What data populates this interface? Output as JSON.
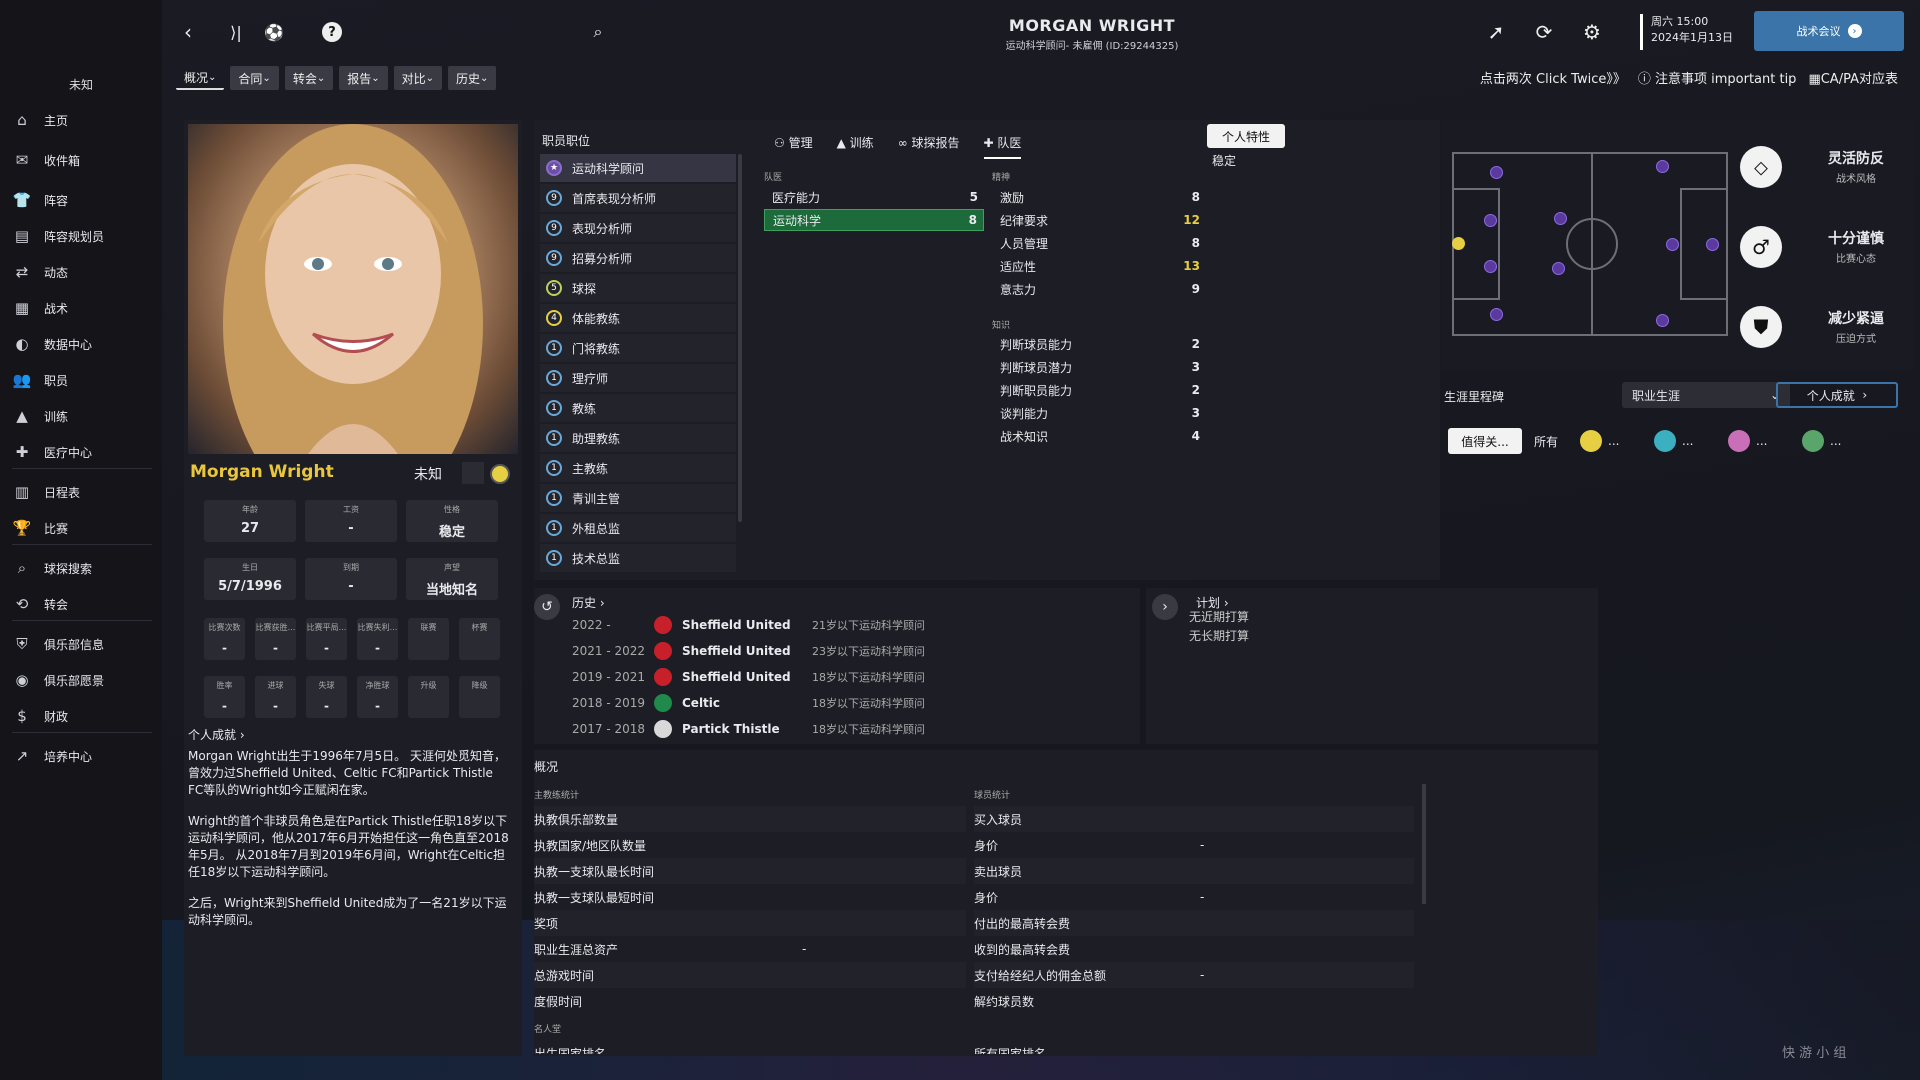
{
  "sidebar": {
    "club": "未知",
    "items": [
      {
        "icon": "home-icon",
        "label": "主页"
      },
      {
        "icon": "inbox-icon",
        "label": "收件箱"
      },
      {
        "icon": "squad-icon",
        "label": "阵容"
      },
      {
        "icon": "squad-planner-icon",
        "label": "阵容规划员"
      },
      {
        "icon": "dynamics-icon",
        "label": "动态"
      },
      {
        "icon": "tactics-icon",
        "label": "战术"
      },
      {
        "icon": "data-hub-icon",
        "label": "数据中心"
      },
      {
        "icon": "staff-icon",
        "label": "职员"
      },
      {
        "icon": "training-icon",
        "label": "训练"
      },
      {
        "icon": "medical-icon",
        "label": "医疗中心"
      },
      {
        "icon": "calendar-icon",
        "label": "日程表"
      },
      {
        "icon": "trophy-icon",
        "label": "比赛"
      },
      {
        "icon": "search-icon",
        "label": "球探搜索"
      },
      {
        "icon": "transfer-icon",
        "label": "转会"
      },
      {
        "icon": "club-info-icon",
        "label": "俱乐部信息"
      },
      {
        "icon": "club-vision-icon",
        "label": "俱乐部愿景"
      },
      {
        "icon": "finance-icon",
        "label": "财政"
      },
      {
        "icon": "development-icon",
        "label": "培养中心"
      }
    ]
  },
  "header": {
    "name": "MORGAN WRIGHT",
    "subtitle": "运动科学顾问- 未雇佣 (ID:29244325)",
    "day_time": "周六 15:00",
    "date": "2024年1月13日",
    "meeting": "战术会议"
  },
  "tabs": [
    "概况",
    "合同",
    "转会",
    "报告",
    "对比",
    "历史"
  ],
  "tips": {
    "click_twice": "点击两次 Click Twice》》",
    "important": "注意事项 important tip",
    "ca_pa": "CA/PA对应表"
  },
  "profile": {
    "name": "Morgan Wright",
    "club": "未知",
    "stats": [
      {
        "label": "年龄",
        "value": "27"
      },
      {
        "label": "工资",
        "value": "-"
      },
      {
        "label": "性格",
        "value": "稳定"
      },
      {
        "label": "生日",
        "value": "5/7/1996"
      },
      {
        "label": "到期",
        "value": "-"
      },
      {
        "label": "声望",
        "value": "当地知名"
      }
    ],
    "mini1": [
      {
        "label": "比赛次数",
        "value": "-"
      },
      {
        "label": "比赛获胜...",
        "value": "-"
      },
      {
        "label": "比赛平局...",
        "value": "-"
      },
      {
        "label": "比赛失利...",
        "value": "-"
      },
      {
        "label": "联赛",
        "value": ""
      },
      {
        "label": "杯赛",
        "value": ""
      }
    ],
    "mini2": [
      {
        "label": "胜率",
        "value": "-"
      },
      {
        "label": "进球",
        "value": "-"
      },
      {
        "label": "失球",
        "value": "-"
      },
      {
        "label": "净胜球",
        "value": "-"
      },
      {
        "label": "升级",
        "value": ""
      },
      {
        "label": "降级",
        "value": ""
      }
    ],
    "achievements_link": "个人成就",
    "bio": [
      "Morgan Wright出生于1996年7月5日。 天涯何处觅知音，曾效力过Sheffield United、Celtic FC和Partick Thistle FC等队的Wright如今正赋闲在家。",
      "Wright的首个非球员角色是在Partick Thistle任职18岁以下运动科学顾问，他从2017年6月开始担任这一角色直至2018年5月。 从2018年7月到2019年6月间，Wright在Celtic担任18岁以下运动科学顾问。",
      "之后，Wright来到Sheffield United成为了一名21岁以下运动科学顾问。"
    ]
  },
  "roles": {
    "title": "职员职位",
    "items": [
      {
        "n": "★",
        "label": "运动科学顾问",
        "c": "p"
      },
      {
        "n": "9",
        "label": "首席表现分析师",
        "c": ""
      },
      {
        "n": "9",
        "label": "表现分析师",
        "c": ""
      },
      {
        "n": "9",
        "label": "招募分析师",
        "c": ""
      },
      {
        "n": "5",
        "label": "球探",
        "c": "g"
      },
      {
        "n": "4",
        "label": "体能教练",
        "c": "y"
      },
      {
        "n": "1",
        "label": "门将教练",
        "c": ""
      },
      {
        "n": "1",
        "label": "理疗师",
        "c": ""
      },
      {
        "n": "1",
        "label": "教练",
        "c": ""
      },
      {
        "n": "1",
        "label": "助理教练",
        "c": ""
      },
      {
        "n": "1",
        "label": "主教练",
        "c": ""
      },
      {
        "n": "1",
        "label": "青训主管",
        "c": ""
      },
      {
        "n": "1",
        "label": "外租总监",
        "c": ""
      },
      {
        "n": "1",
        "label": "技术总监",
        "c": ""
      }
    ]
  },
  "attr_tabs": [
    "管理",
    "训练",
    "球探报告",
    "队医"
  ],
  "traits": {
    "button": "个人特性",
    "value": "稳定"
  },
  "medical": {
    "title": "队医",
    "rows": [
      {
        "label": "医疗能力",
        "value": "5"
      },
      {
        "label": "运动科学",
        "value": "8"
      }
    ]
  },
  "mental": {
    "title": "精神",
    "rows": [
      {
        "label": "激励",
        "value": "8"
      },
      {
        "label": "纪律要求",
        "value": "12"
      },
      {
        "label": "人员管理",
        "value": "8"
      },
      {
        "label": "适应性",
        "value": "13"
      },
      {
        "label": "意志力",
        "value": "9"
      }
    ]
  },
  "knowledge": {
    "title": "知识",
    "rows": [
      {
        "label": "判断球员能力",
        "value": "2"
      },
      {
        "label": "判断球员潜力",
        "value": "3"
      },
      {
        "label": "判断职员能力",
        "value": "2"
      },
      {
        "label": "谈判能力",
        "value": "3"
      },
      {
        "label": "战术知识",
        "value": "4"
      }
    ]
  },
  "history": {
    "title": "历史",
    "rows": [
      {
        "years": "2022 -",
        "club": "Sheffield United",
        "role": "21岁以下运动科学顾问",
        "color": "#c8202a"
      },
      {
        "years": "2021 - 2022",
        "club": "Sheffield United",
        "role": "23岁以下运动科学顾问",
        "color": "#c8202a"
      },
      {
        "years": "2019 - 2021",
        "club": "Sheffield United",
        "role": "18岁以下运动科学顾问",
        "color": "#c8202a"
      },
      {
        "years": "2018 - 2019",
        "club": "Celtic",
        "role": "18岁以下运动科学顾问",
        "color": "#1f8a4c"
      },
      {
        "years": "2017 - 2018",
        "club": "Partick Thistle",
        "role": "18岁以下运动科学顾问",
        "color": "#d8d8d8"
      }
    ]
  },
  "plans": {
    "title": "计划",
    "rows": [
      "无近期打算",
      "无长期打算"
    ]
  },
  "overview": {
    "title": "概况",
    "coach_title": "主教练统计",
    "player_title": "球员统计",
    "coach_rows": [
      {
        "label": "执教俱乐部数量",
        "value": ""
      },
      {
        "label": "执教国家/地区队数量",
        "value": ""
      },
      {
        "label": "执教一支球队最长时间",
        "value": ""
      },
      {
        "label": "执教一支球队最短时间",
        "value": ""
      },
      {
        "label": "奖项",
        "value": ""
      },
      {
        "label": "职业生涯总资产",
        "value": "-"
      },
      {
        "label": "总游戏时间",
        "value": ""
      },
      {
        "label": "度假时间",
        "value": ""
      }
    ],
    "player_rows": [
      {
        "label": "买入球员",
        "value": ""
      },
      {
        "label": "身价",
        "value": "-"
      },
      {
        "label": "卖出球员",
        "value": ""
      },
      {
        "label": "身价",
        "value": "-"
      },
      {
        "label": "付出的最高转会费",
        "value": ""
      },
      {
        "label": "收到的最高转会费",
        "value": ""
      },
      {
        "label": "支付给经纪人的佣金总额",
        "value": "-"
      },
      {
        "label": "解约球员数",
        "value": ""
      }
    ],
    "hall_of_fame": "名人堂",
    "cut1": "出生国家排名",
    "cut2": "所有国家排名"
  },
  "tactics": [
    {
      "icon": "flexible-defense-icon",
      "title": "灵活防反",
      "sub": "战术风格"
    },
    {
      "icon": "cautious-icon",
      "title": "十分谨慎",
      "sub": "比赛心态"
    },
    {
      "icon": "pressing-icon",
      "title": "减少紧逼",
      "sub": "压迫方式"
    }
  ],
  "milestones": {
    "title": "生涯里程碑",
    "dropdown": "职业生涯",
    "achievements": "个人成就",
    "filter_button": "值得关...",
    "all": "所有",
    "counts": [
      "...",
      "...",
      "...",
      "..."
    ],
    "filter_colors": [
      "#e6cf43",
      "#3ab0c0",
      "#c86fb8",
      "#5aa66a"
    ]
  },
  "watermark": "快 游 小 组"
}
